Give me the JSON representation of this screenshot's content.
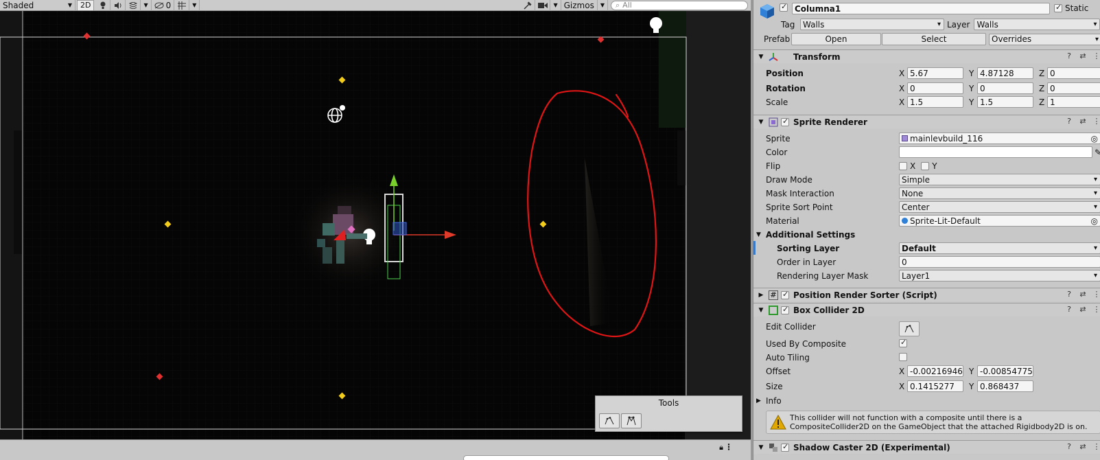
{
  "scene": {
    "toolbar": {
      "shading_mode": "Shaded",
      "mode_2d": "2D",
      "hidden_count": "0",
      "gizmos_label": "Gizmos",
      "search_placeholder": "All"
    },
    "tools_overlay": {
      "title": "Tools"
    }
  },
  "inspector": {
    "object_name": "Columna1",
    "static_label": "Static",
    "tag_label": "Tag",
    "tag_value": "Walls",
    "layer_label": "Layer",
    "layer_value": "Walls",
    "prefab_label": "Prefab",
    "prefab_open": "Open",
    "prefab_select": "Select",
    "prefab_overrides": "Overrides",
    "transform": {
      "title": "Transform",
      "position_label": "Position",
      "rotation_label": "Rotation",
      "scale_label": "Scale",
      "position": {
        "x": "5.67",
        "y": "4.87128",
        "z": "0"
      },
      "rotation": {
        "x": "0",
        "y": "0",
        "z": "0"
      },
      "scale": {
        "x": "1.5",
        "y": "1.5",
        "z": "1"
      }
    },
    "sprite_renderer": {
      "title": "Sprite Renderer",
      "sprite_label": "Sprite",
      "sprite_value": "mainlevbuild_116",
      "color_label": "Color",
      "flip_label": "Flip",
      "flip_x": "X",
      "flip_y": "Y",
      "draw_mode_label": "Draw Mode",
      "draw_mode_value": "Simple",
      "mask_label": "Mask Interaction",
      "mask_value": "None",
      "sort_point_label": "Sprite Sort Point",
      "sort_point_value": "Center",
      "material_label": "Material",
      "material_value": "Sprite-Lit-Default",
      "additional_settings": "Additional Settings",
      "sorting_layer_label": "Sorting Layer",
      "sorting_layer_value": "Default",
      "order_label": "Order in Layer",
      "order_value": "0",
      "rendering_mask_label": "Rendering Layer Mask",
      "rendering_mask_value": "Layer1"
    },
    "position_render_sorter": {
      "title": "Position Render Sorter (Script)"
    },
    "box_collider": {
      "title": "Box Collider 2D",
      "edit_label": "Edit Collider",
      "used_by_composite_label": "Used By Composite",
      "auto_tiling_label": "Auto Tiling",
      "offset_label": "Offset",
      "offset": {
        "x": "-0.00216946",
        "y": "-0.00854775"
      },
      "size_label": "Size",
      "size": {
        "x": "0.1415277",
        "y": "0.868437"
      },
      "info_label": "Info",
      "warning": "This collider will not function with a composite until there is a CompositeCollider2D on the GameObject that the attached Rigidbody2D is on."
    },
    "shadow_caster": {
      "title": "Shadow Caster 2D (Experimental)"
    }
  }
}
